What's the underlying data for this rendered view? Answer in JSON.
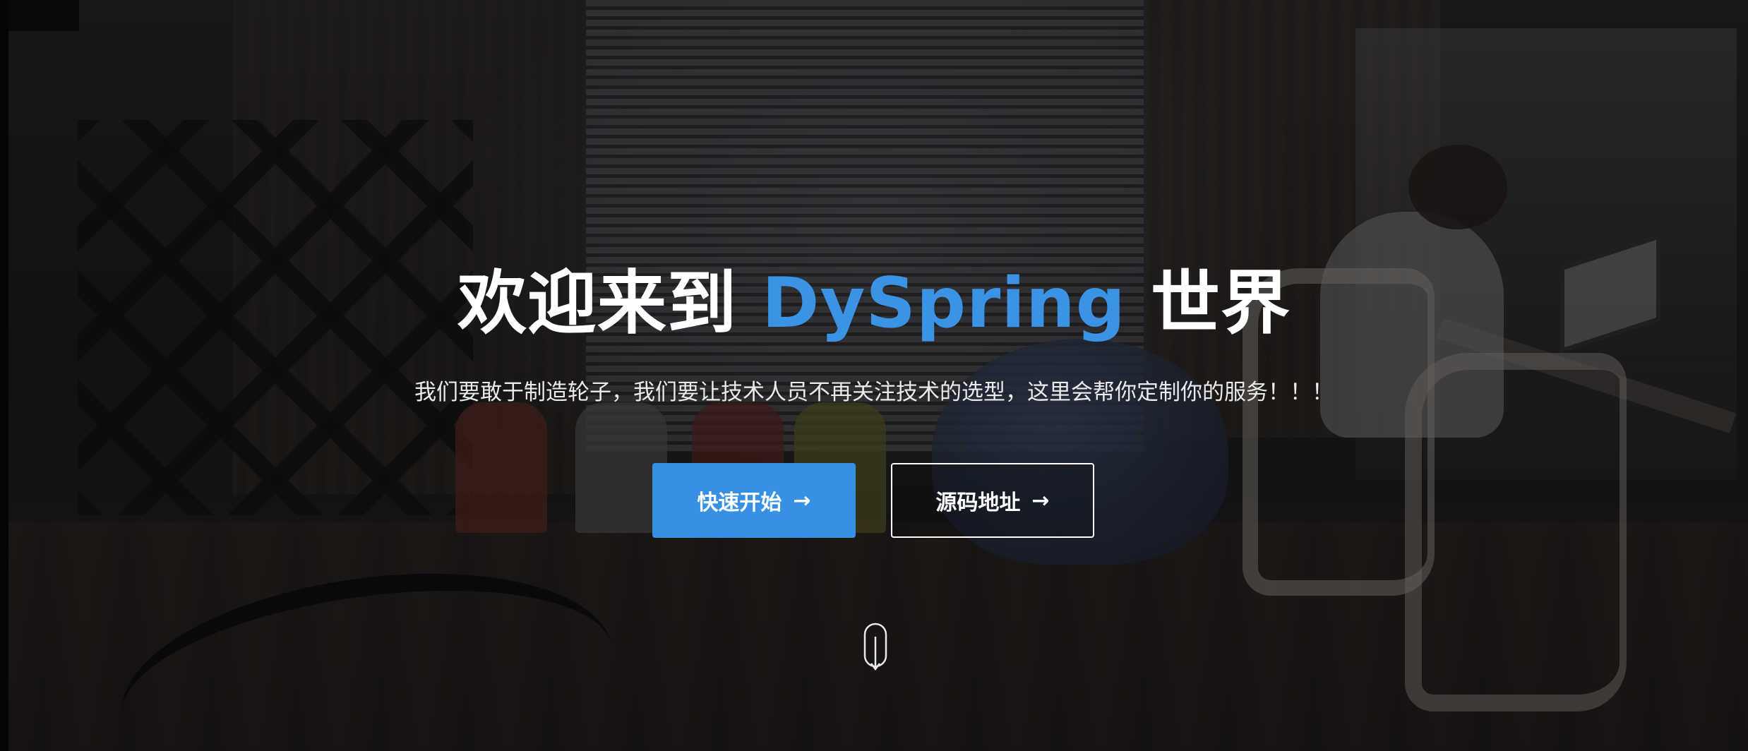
{
  "hero": {
    "title_prefix": "欢迎来到 ",
    "title_accent": "DySpring",
    "title_suffix": " 世界",
    "subtitle": "我们要敢于制造轮子，我们要让技术人员不再关注技术的选型，这里会帮你定制你的服务！！！",
    "accent_color": "#3b93e6"
  },
  "buttons": {
    "quick_start": {
      "label": "快速开始",
      "arrow": "→"
    },
    "source": {
      "label": "源码地址",
      "arrow": "→"
    }
  },
  "icons": {
    "scroll_down": "mouse-scroll-icon"
  }
}
